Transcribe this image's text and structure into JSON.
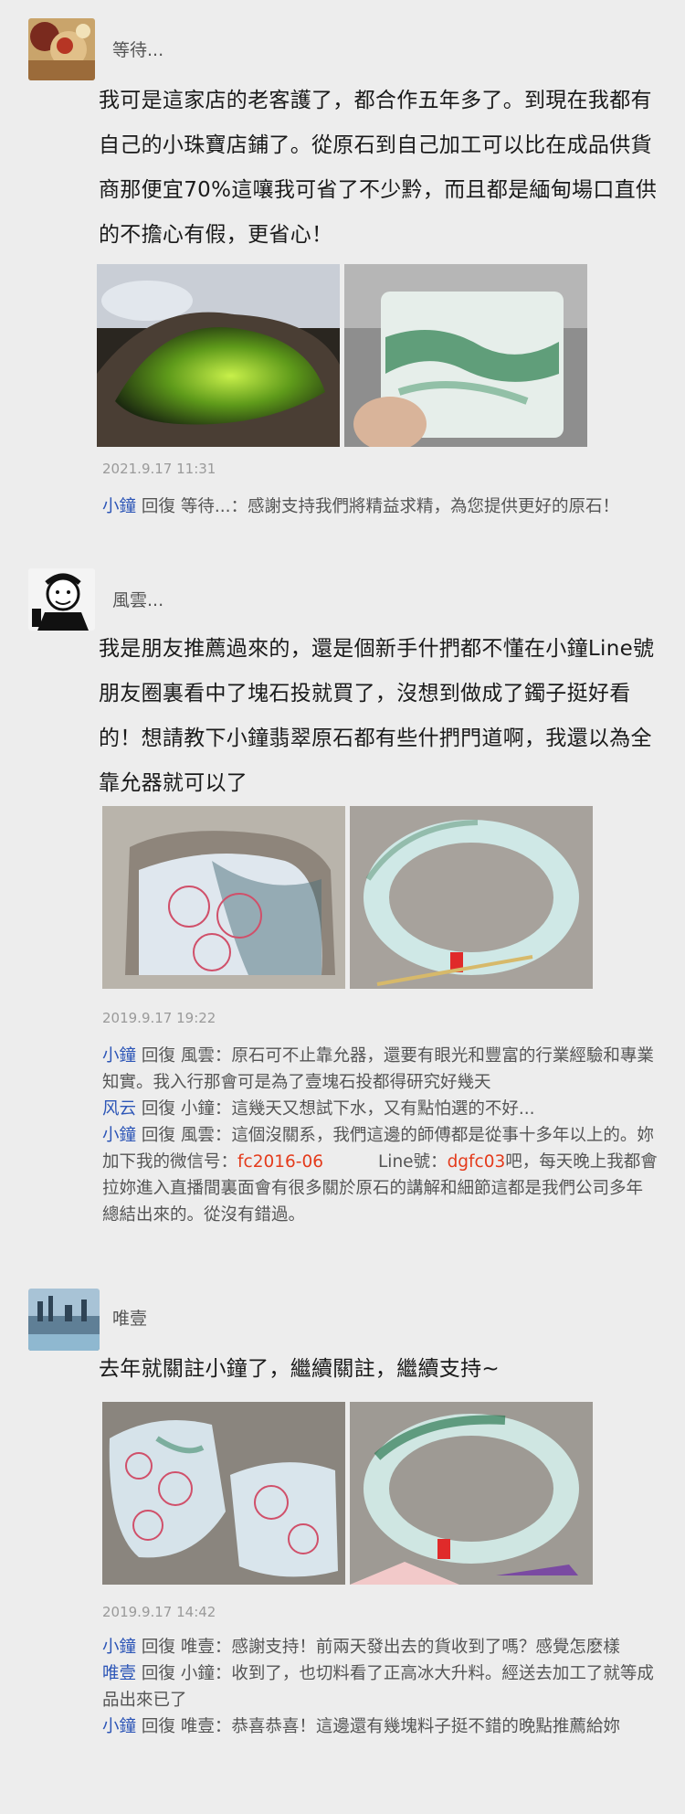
{
  "posts": [
    {
      "username": "等待...",
      "text": "我可是這家店的老客護了，都合作五年多了。到現在我都有自己的小珠寶店鋪了。從原石到自己加工可以比在成品供貨商那便宜70%這嚷我可省了不少黔，而且都是緬甸場口直供的不擔心有假，更省心！",
      "timestamp": "2021.9.17  11:31",
      "replies": [
        {
          "name": "小鐘",
          "verb": "回復",
          "target": "等待...",
          "text": "感謝支持我們將精益求精，為您提供更好的原石！"
        }
      ]
    },
    {
      "username": "風雲...",
      "text": "我是朋友推薦過來的，還是個新手什捫都不懂在小鐘Line號朋友圈裏看中了塊石投就買了，沒想到做成了鐲子挺好看的！想請教下小鐘翡翠原石都有些什捫門道啊，我還以為全靠允器就可以了",
      "timestamp": "2019.9.17  19:22",
      "replies": [
        {
          "name": "小鐘",
          "verb": "回復",
          "target": "風雲",
          "text": "原石可不止靠允器，還要有眼光和豐富的行業經驗和專業知實。我入行那會可是為了壹塊石投都得研究好幾天"
        },
        {
          "name": "风云",
          "verb": "回復",
          "target": "小鐘",
          "text": "這幾天又想試下水，又有點怕選的不好..."
        },
        {
          "name": "小鐘",
          "verb": "回復",
          "target": "風雲",
          "text": "這個沒關系，我們這邊的師傅都是從事十多年以上的。妳加下我的微信号：",
          "wechat_id": "fc2016-06",
          "line_label": "Line號：",
          "line_id": "dgfc03",
          "text_after": "吧，每天晚上我都會拉妳進入直播間裏面會有很多關於原石的講解和細節這都是我們公司多年總結出來的。從沒有錯過。"
        }
      ]
    },
    {
      "username": "唯壹",
      "text": "去年就關註小鐘了，繼續關註，繼續支持~",
      "timestamp": "2019.9.17  14:42",
      "replies": [
        {
          "name": "小鐘",
          "verb": "回復",
          "target": "唯壹",
          "text": "感謝支持！前兩天發出去的貨收到了嗎？感覺怎麽樣"
        },
        {
          "name": "唯壹",
          "verb": "回復",
          "target": "小鐘",
          "text": "收到了，也切料看了正高冰大升料。經送去加工了就等成品出來已了"
        },
        {
          "name": "小鐘",
          "verb": "回復",
          "target": "唯壹",
          "text": "恭喜恭喜！這邊還有幾塊料子挺不錯的晚點推薦給妳"
        }
      ]
    }
  ],
  "colors": {
    "background": "#ededed",
    "reply_name": "#2d56b7",
    "highlight": "#e43b1c",
    "meta": "#9a9a9a"
  }
}
